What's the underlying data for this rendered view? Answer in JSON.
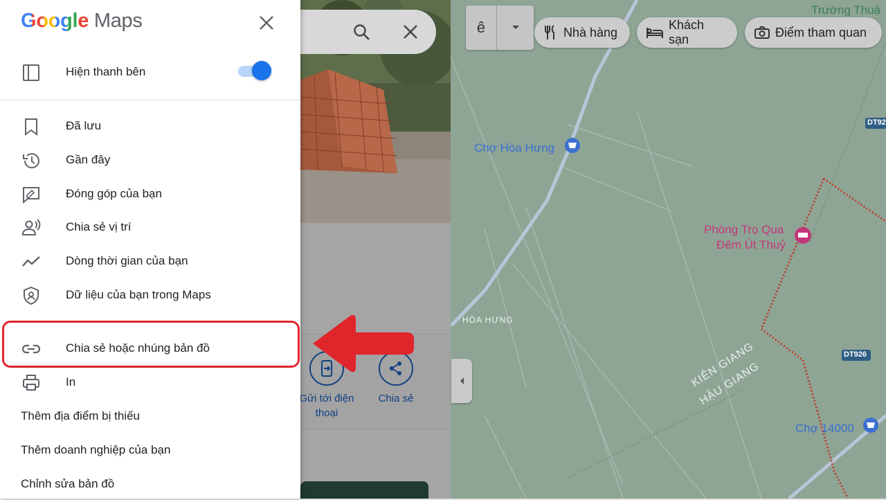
{
  "app": {
    "logo_google": "Google",
    "logo_maps": "Maps"
  },
  "menu": {
    "sidebar_toggle_label": "Hiện thanh bên",
    "sidebar_toggle_on": true,
    "items": [
      {
        "label": "Đã lưu",
        "icon": "bookmark-icon"
      },
      {
        "label": "Gần đây",
        "icon": "history-icon"
      },
      {
        "label": "Đóng góp của bạn",
        "icon": "contribute-icon"
      },
      {
        "label": "Chia sẻ vị trí",
        "icon": "location-sharing-icon"
      },
      {
        "label": "Dòng thời gian của bạn",
        "icon": "timeline-icon"
      },
      {
        "label": "Dữ liệu của bạn trong Maps",
        "icon": "shield-icon"
      },
      {
        "label": "Chia sẻ hoặc nhúng bản đồ",
        "icon": "link-icon"
      },
      {
        "label": "In",
        "icon": "print-icon"
      }
    ],
    "text_items": [
      {
        "label": "Thêm địa điểm bị thiếu"
      },
      {
        "label": "Thêm doanh nghiệp của bạn"
      },
      {
        "label": "Chỉnh sửa bản đồ"
      }
    ]
  },
  "place_pane": {
    "actions": [
      {
        "label": "Gửi tới điện thoại",
        "icon": "send-to-phone-icon"
      },
      {
        "label": "Chia sẻ",
        "icon": "share-icon"
      }
    ]
  },
  "map": {
    "layer_letter": "ê",
    "chips": [
      {
        "label": "Nhà hàng",
        "icon": "restaurant-icon"
      },
      {
        "label": "Khách sạn",
        "icon": "hotel-icon"
      },
      {
        "label": "Điểm tham quan",
        "icon": "camera-icon"
      }
    ],
    "labels": {
      "cho_hoa_hung": "Chợ Hòa Hưng",
      "phong_tro_line1": "Phòng Trọ Qua",
      "phong_tro_line2": "Đêm Út Thuỷ",
      "hoa_hung": "HÒA HƯNG",
      "kien_giang": "KIÊN GIANG",
      "hau_giang": "HẬU GIANG",
      "cho_14000": "Chợ 14000",
      "truong_thuan": "Trường Thuậ",
      "dt926_a": "DT92",
      "dt926_b": "DT926"
    },
    "colors": {
      "map_bg": "#8ea595",
      "road": "#b7c6d8",
      "boundary": "#c0392b",
      "poi_blue": "#3b6fd1",
      "poi_pink": "#c2377a"
    }
  },
  "annotation": {
    "color": "#e0252b"
  }
}
